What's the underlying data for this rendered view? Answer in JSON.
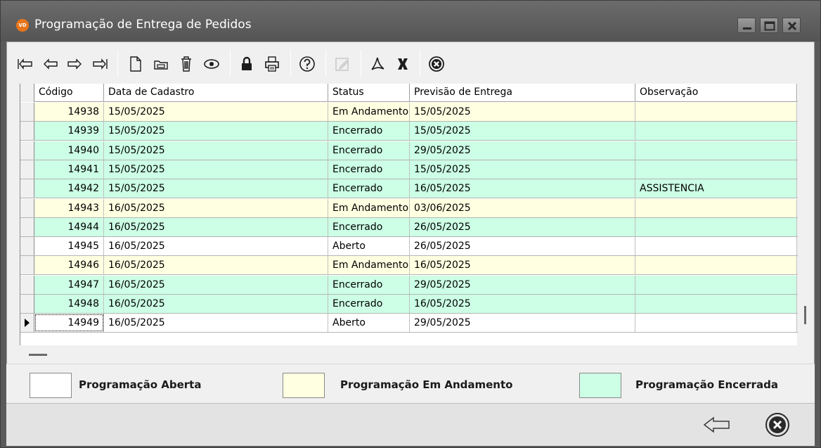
{
  "window": {
    "app_icon_text": "VD",
    "title": "Programação de Entrega de Pedidos"
  },
  "toolbar": {
    "buttons": [
      {
        "name": "first-record",
        "icon": "first-arrow-icon"
      },
      {
        "name": "previous-record",
        "icon": "left-arrow-icon"
      },
      {
        "name": "next-record",
        "icon": "right-arrow-icon"
      },
      {
        "name": "last-record",
        "icon": "last-arrow-icon"
      },
      {
        "name": "new-record",
        "icon": "new-document-icon"
      },
      {
        "name": "edit-record",
        "icon": "folder-edit-icon"
      },
      {
        "name": "delete-record",
        "icon": "trash-icon"
      },
      {
        "name": "view-record",
        "icon": "eye-icon"
      },
      {
        "name": "lock",
        "icon": "lock-icon"
      },
      {
        "name": "print",
        "icon": "printer-icon"
      },
      {
        "name": "help",
        "icon": "help-icon"
      },
      {
        "name": "edit-disabled",
        "icon": "pencil-disabled-icon"
      },
      {
        "name": "export-pdf",
        "icon": "pdf-icon"
      },
      {
        "name": "export-excel",
        "icon": "excel-icon"
      },
      {
        "name": "close",
        "icon": "close-circle-icon"
      }
    ]
  },
  "grid": {
    "columns": [
      "Código",
      "Data de Cadastro",
      "Status",
      "Previsão de Entrega",
      "Observação"
    ],
    "rows": [
      {
        "codigo": "14938",
        "cadastro": "15/05/2025",
        "status": "Em Andamento",
        "previsao": "15/05/2025",
        "observacao": "",
        "state": "andamento"
      },
      {
        "codigo": "14939",
        "cadastro": "15/05/2025",
        "status": "Encerrado",
        "previsao": "15/05/2025",
        "observacao": "",
        "state": "encerrado"
      },
      {
        "codigo": "14940",
        "cadastro": "15/05/2025",
        "status": "Encerrado",
        "previsao": "29/05/2025",
        "observacao": "",
        "state": "encerrado"
      },
      {
        "codigo": "14941",
        "cadastro": "15/05/2025",
        "status": "Encerrado",
        "previsao": "15/05/2025",
        "observacao": "",
        "state": "encerrado"
      },
      {
        "codigo": "14942",
        "cadastro": "15/05/2025",
        "status": "Encerrado",
        "previsao": "16/05/2025",
        "observacao": "ASSISTENCIA",
        "state": "encerrado"
      },
      {
        "codigo": "14943",
        "cadastro": "16/05/2025",
        "status": "Em Andamento",
        "previsao": "03/06/2025",
        "observacao": "",
        "state": "andamento"
      },
      {
        "codigo": "14944",
        "cadastro": "16/05/2025",
        "status": "Encerrado",
        "previsao": "26/05/2025",
        "observacao": "",
        "state": "encerrado"
      },
      {
        "codigo": "14945",
        "cadastro": "16/05/2025",
        "status": "Aberto",
        "previsao": "26/05/2025",
        "observacao": "",
        "state": "aberto"
      },
      {
        "codigo": "14946",
        "cadastro": "16/05/2025",
        "status": "Em Andamento",
        "previsao": "16/05/2025",
        "observacao": "",
        "state": "andamento"
      },
      {
        "codigo": "14947",
        "cadastro": "16/05/2025",
        "status": "Encerrado",
        "previsao": "29/05/2025",
        "observacao": "",
        "state": "encerrado"
      },
      {
        "codigo": "14948",
        "cadastro": "16/05/2025",
        "status": "Encerrado",
        "previsao": "16/05/2025",
        "observacao": "",
        "state": "encerrado"
      },
      {
        "codigo": "14949",
        "cadastro": "16/05/2025",
        "status": "Aberto",
        "previsao": "29/05/2025",
        "observacao": "",
        "state": "aberto",
        "selected": true
      }
    ]
  },
  "legend": {
    "items": [
      {
        "label": "Programação Aberta",
        "state": "aberto"
      },
      {
        "label": "Programação Em Andamento",
        "state": "andamento"
      },
      {
        "label": "Programação Encerrada",
        "state": "encerrado"
      }
    ]
  },
  "colors": {
    "aberto": "#ffffff",
    "andamento": "#ffffe1",
    "encerrado": "#ccffe5",
    "titlebar": "#5f5f5f"
  },
  "footer": {
    "buttons": [
      {
        "name": "back",
        "icon": "back-arrow-icon"
      },
      {
        "name": "exit",
        "icon": "close-circle-icon"
      }
    ]
  }
}
